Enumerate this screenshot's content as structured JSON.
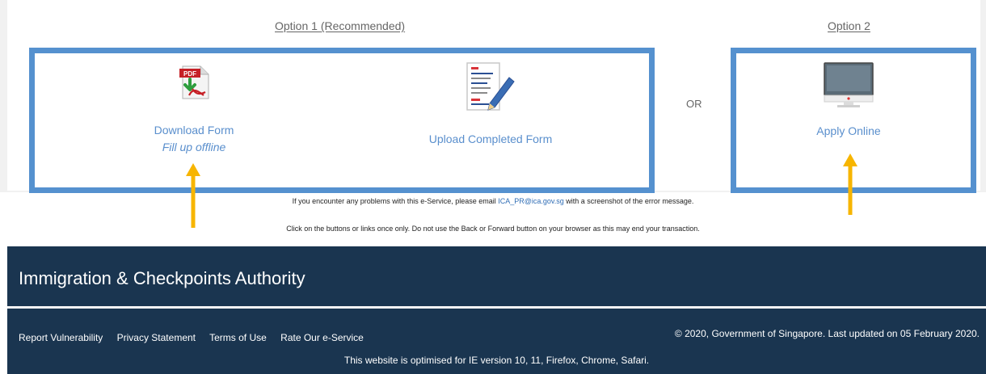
{
  "options": {
    "option1_title": "Option 1 (Recommended)",
    "option2_title": "Option 2",
    "or_label": "OR"
  },
  "tiles": {
    "download": {
      "label": "Download Form",
      "sublabel": "Fill up offline",
      "icon": "pdf-download-icon"
    },
    "upload": {
      "label": "Upload Completed Form",
      "icon": "document-edit-icon"
    },
    "apply": {
      "label": "Apply Online",
      "icon": "monitor-icon"
    }
  },
  "notices": {
    "problem_prefix": "If you encounter any problems with this e-Service, please email ",
    "email": "ICA_PR@ica.gov.sg",
    "problem_suffix": " with a screenshot of the error message.",
    "click_once": "Click on the buttons or links once only. Do not use the Back or Forward button on your browser as this may end your transaction."
  },
  "footer": {
    "agency": "Immigration & Checkpoints Authority",
    "links": [
      "Report Vulnerability",
      "Privacy Statement",
      "Terms of Use",
      "Rate Our e-Service"
    ],
    "copyright": "© 2020, Government of Singapore. Last updated on 05 February 2020.",
    "optimised": "This website is optimised for IE version 10, 11, Firefox, Chrome, Safari."
  },
  "colors": {
    "box_border": "#5591cf",
    "link_text": "#5a8fcd",
    "footer_bg": "#1a3550",
    "annotation_arrow": "#f7b500"
  }
}
